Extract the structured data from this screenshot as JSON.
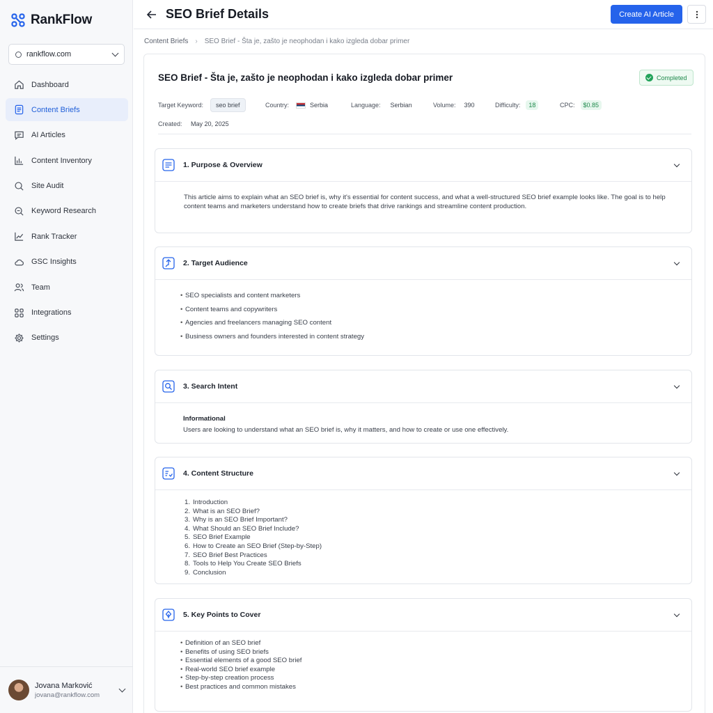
{
  "brand": {
    "name": "RankFlow",
    "accent": "#2563eb"
  },
  "site_select": {
    "value": "rankflow.com"
  },
  "nav": [
    {
      "label": "Dashboard",
      "icon": "home-icon",
      "active": false
    },
    {
      "label": "Content Briefs",
      "icon": "document-icon",
      "active": true
    },
    {
      "label": "AI Articles",
      "icon": "chat-icon",
      "active": false
    },
    {
      "label": "Content Inventory",
      "icon": "bar-chart-icon",
      "active": false
    },
    {
      "label": "Site Audit",
      "icon": "search-icon",
      "active": false
    },
    {
      "label": "Keyword Research",
      "icon": "keyword-search-icon",
      "active": false
    },
    {
      "label": "Rank Tracker",
      "icon": "trend-icon",
      "active": false
    },
    {
      "label": "GSC Insights",
      "icon": "cloud-icon",
      "active": false
    },
    {
      "label": "Team",
      "icon": "users-icon",
      "active": false
    },
    {
      "label": "Integrations",
      "icon": "grid-icon",
      "active": false
    },
    {
      "label": "Settings",
      "icon": "gear-icon",
      "active": false
    }
  ],
  "user": {
    "name": "Jovana Marković",
    "email": "jovana@rankflow.com"
  },
  "header": {
    "title": "SEO Brief Details",
    "primary_button": "Create AI Article"
  },
  "breadcrumb": {
    "parent": "Content Briefs",
    "current": "SEO Brief - Šta je, zašto je neophodan i kako izgleda dobar primer"
  },
  "brief": {
    "title": "SEO Brief - Šta je, zašto je neophodan i kako izgleda dobar primer",
    "status": "Completed",
    "meta": {
      "keyword_label": "Target Keyword:",
      "keyword": "seo brief",
      "country_label": "Country:",
      "country": "Serbia",
      "language_label": "Language:",
      "language": "Serbian",
      "volume_label": "Volume:",
      "volume": "390",
      "difficulty_label": "Difficulty:",
      "difficulty": "18",
      "cpc_label": "CPC:",
      "cpc": "$0.85",
      "created_label": "Created:",
      "created": "May 20, 2025"
    }
  },
  "sections": {
    "purpose": {
      "title": "1. Purpose & Overview",
      "text": "This article aims to explain what an SEO brief is, why it's essential for content success, and what a well-structured SEO brief example looks like. The goal is to help content teams and marketers understand how to create briefs that drive rankings and streamline content production."
    },
    "audience": {
      "title": "2. Target Audience",
      "items": [
        "SEO specialists and content marketers",
        "Content teams and copywriters",
        "Agencies and freelancers managing SEO content",
        "Business owners and founders interested in content strategy"
      ]
    },
    "intent": {
      "title": "3. Search Intent",
      "type": "Informational",
      "text": "Users are looking to understand what an SEO brief is, why it matters, and how to create or use one effectively."
    },
    "structure": {
      "title": "4. Content Structure",
      "items": [
        "Introduction",
        "What is an SEO Brief?",
        "Why is an SEO Brief Important?",
        "What Should an SEO Brief Include?",
        "SEO Brief Example",
        "How to Create an SEO Brief (Step-by-Step)",
        "SEO Brief Best Practices",
        "Tools to Help You Create SEO Briefs",
        "Conclusion"
      ]
    },
    "key_points": {
      "title": "5. Key Points to Cover",
      "items": [
        "Definition of an SEO brief",
        "Benefits of using SEO briefs",
        "Essential elements of a good SEO brief",
        "Real-world SEO brief example",
        "Step-by-step creation process",
        "Best practices and common mistakes"
      ]
    }
  }
}
